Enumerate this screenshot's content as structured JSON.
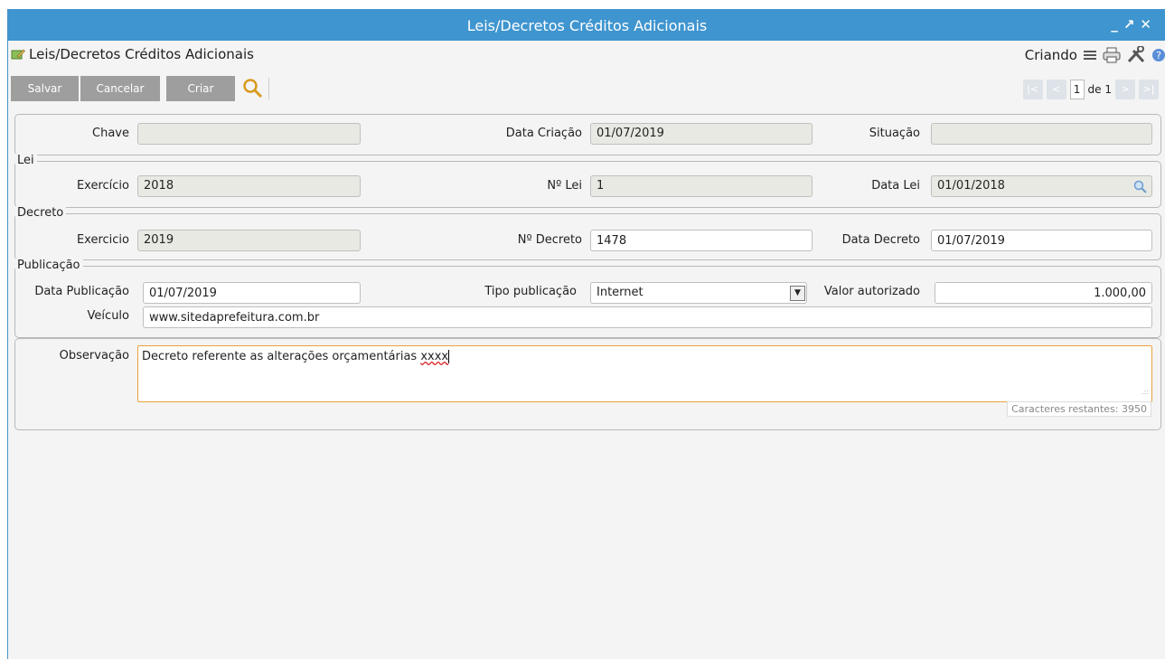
{
  "window": {
    "title": "Leis/Decretos Créditos Adicionais",
    "controls": {
      "minimize": "_",
      "maximize": "↗",
      "close": "✕"
    }
  },
  "header": {
    "title": "Leis/Decretos Créditos Adicionais",
    "mode": "Criando",
    "icons": [
      "menu-icon",
      "print-icon",
      "tools-icon",
      "help-icon"
    ]
  },
  "toolbar": {
    "save_label": "Salvar",
    "cancel_label": "Cancelar",
    "create_label": "Criar"
  },
  "pager": {
    "current": "1",
    "of_label": "de 1"
  },
  "main": {
    "chave_label": "Chave",
    "chave_value": "",
    "data_criacao_label": "Data Criação",
    "data_criacao_value": "01/07/2019",
    "situacao_label": "Situação",
    "situacao_value": ""
  },
  "lei": {
    "legend": "Lei",
    "exercicio_label": "Exercício",
    "exercicio_value": "2018",
    "numero_label": "Nº Lei",
    "numero_value": "1",
    "data_label": "Data Lei",
    "data_value": "01/01/2018"
  },
  "decreto": {
    "legend": "Decreto",
    "exercicio_label": "Exercicio",
    "exercicio_value": "2019",
    "numero_label": "Nº Decreto",
    "numero_value": "1478",
    "data_label": "Data Decreto",
    "data_value": "01/07/2019"
  },
  "publicacao": {
    "legend": "Publicação",
    "data_label": "Data Publicação",
    "data_value": "01/07/2019",
    "tipo_label": "Tipo publicação",
    "tipo_value": "Internet",
    "valor_label": "Valor autorizado",
    "valor_value": "1.000,00",
    "veiculo_label": "Veículo",
    "veiculo_value": "www.sitedaprefeitura.com.br"
  },
  "observacao": {
    "label": "Observação",
    "text_main": "Decreto referente as alterações orçamentárias ",
    "text_misspelled": "xxxx",
    "remaining": "Caracteres restantes: 3950"
  },
  "colors": {
    "titlebar": "#3f95cf",
    "button": "#9e9e9e",
    "focus": "#e8a23a"
  }
}
